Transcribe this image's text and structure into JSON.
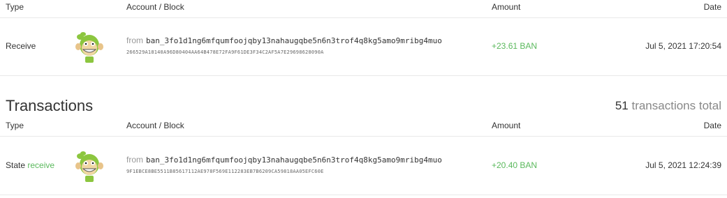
{
  "headers": {
    "type": "Type",
    "account": "Account / Block",
    "amount": "Amount",
    "date": "Date"
  },
  "pending": {
    "type": "Receive",
    "from_label": "from",
    "address": "ban_3fo1d1ng6mfqumfoojqby13nahaugqbe5n6n3trof4q8kg5amo9mribg4muo",
    "hash": "266529A18140A96D80404AA64B478E72FA9F61DE3F34C2AF5A7E29698628090A",
    "amount": "+23.61 BAN",
    "date": "Jul 5, 2021 17:20:54"
  },
  "transactions": {
    "title": "Transactions",
    "count": "51",
    "count_label": " transactions total",
    "items": [
      {
        "type_prefix": "State",
        "type": "receive",
        "from_label": "from",
        "address": "ban_3fo1d1ng6mfqumfoojqby13nahaugqbe5n6n3trof4q8kg5amo9mribg4muo",
        "hash": "9F1EBCE8BE5511B85617112AE978F569E112283EB7B6209CA59818AA05EFC60E",
        "amount": "+20.40 BAN",
        "date": "Jul 5, 2021 12:24:39"
      }
    ]
  },
  "colors": {
    "accent_green": "#5bb95d",
    "divider": "#e9e9e9"
  },
  "icons": {
    "avatar": "monkey-avatar-icon"
  }
}
